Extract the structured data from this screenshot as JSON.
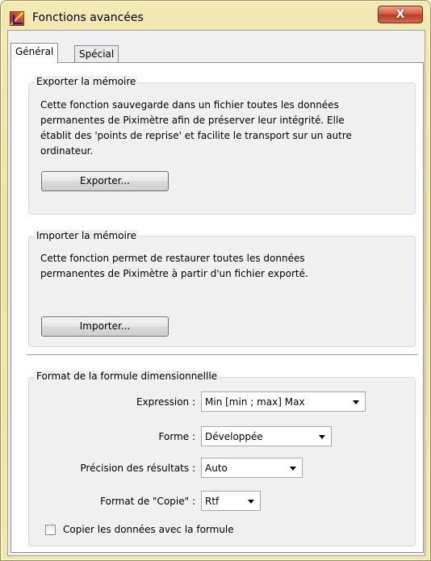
{
  "window": {
    "title": "Fonctions avancées",
    "close_glyph": "X",
    "colors": {
      "frame": "#efe6a8",
      "close": "#c94a33"
    }
  },
  "tabs": [
    {
      "label": "Général",
      "active": true
    },
    {
      "label": "Spécial",
      "active": false
    }
  ],
  "export": {
    "group_title": "Exporter la mémoire",
    "description_lines": [
      "Cette fonction sauvegarde dans un fichier toutes les données",
      "permanentes de Piximètre afin de préserver leur intégrité. Elle",
      "établit des 'points de reprise' et facilite le transport sur un autre",
      "ordinateur."
    ],
    "button_label": "Exporter..."
  },
  "import": {
    "group_title": "Importer la mémoire",
    "description_lines": [
      "Cette fonction permet de restaurer toutes les données",
      "permanentes de Piximètre à partir d'un fichier exporté."
    ],
    "button_label": "Importer..."
  },
  "format": {
    "group_title": "Format de la formule dimensionnellle",
    "expression": {
      "label": "Expression :",
      "value": "Min [min ; max] Max"
    },
    "forme": {
      "label": "Forme :",
      "value": "Développée"
    },
    "precision": {
      "label": "Précision des résultats :",
      "value": "Auto"
    },
    "copie": {
      "label": "Format de \"Copie\" :",
      "value": "Rtf"
    },
    "copy_with_formula": {
      "label": "Copier les données avec la formule",
      "checked": false
    }
  }
}
